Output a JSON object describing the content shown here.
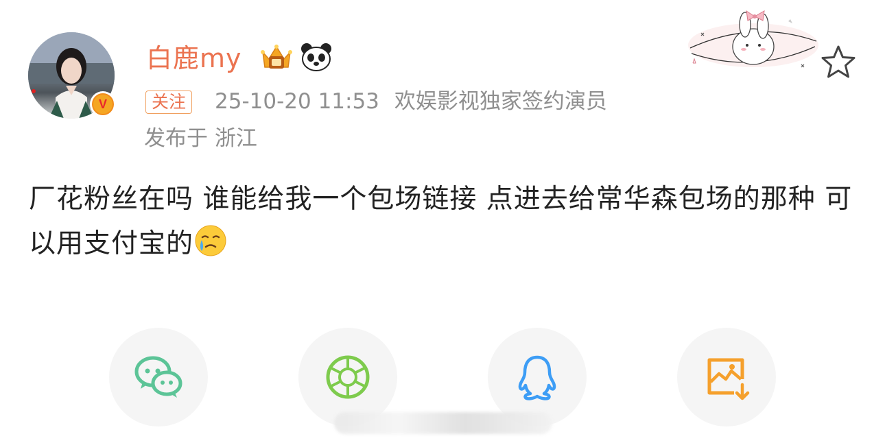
{
  "post": {
    "author": {
      "name": "白鹿my",
      "follow_label": "关注",
      "timestamp": "25-10-20 11:53",
      "title": "欢娱影视独家签约演员",
      "location": "发布于 浙江"
    },
    "text": "厂花粉丝在吗 谁能给我一个包场链接 点进去给常华森包场的那种 可以用支付宝的"
  },
  "share": {
    "items": [
      {
        "icon": "wechat-icon",
        "color": "#5cc497"
      },
      {
        "icon": "moments-icon",
        "color": "#7ecb4d"
      },
      {
        "icon": "qq-icon",
        "color": "#3d9df5"
      },
      {
        "icon": "save-image-icon",
        "color": "#f5a02c"
      }
    ]
  },
  "colors": {
    "accent": "#eb7350",
    "meta": "#8f8f8f",
    "text": "#222222"
  }
}
